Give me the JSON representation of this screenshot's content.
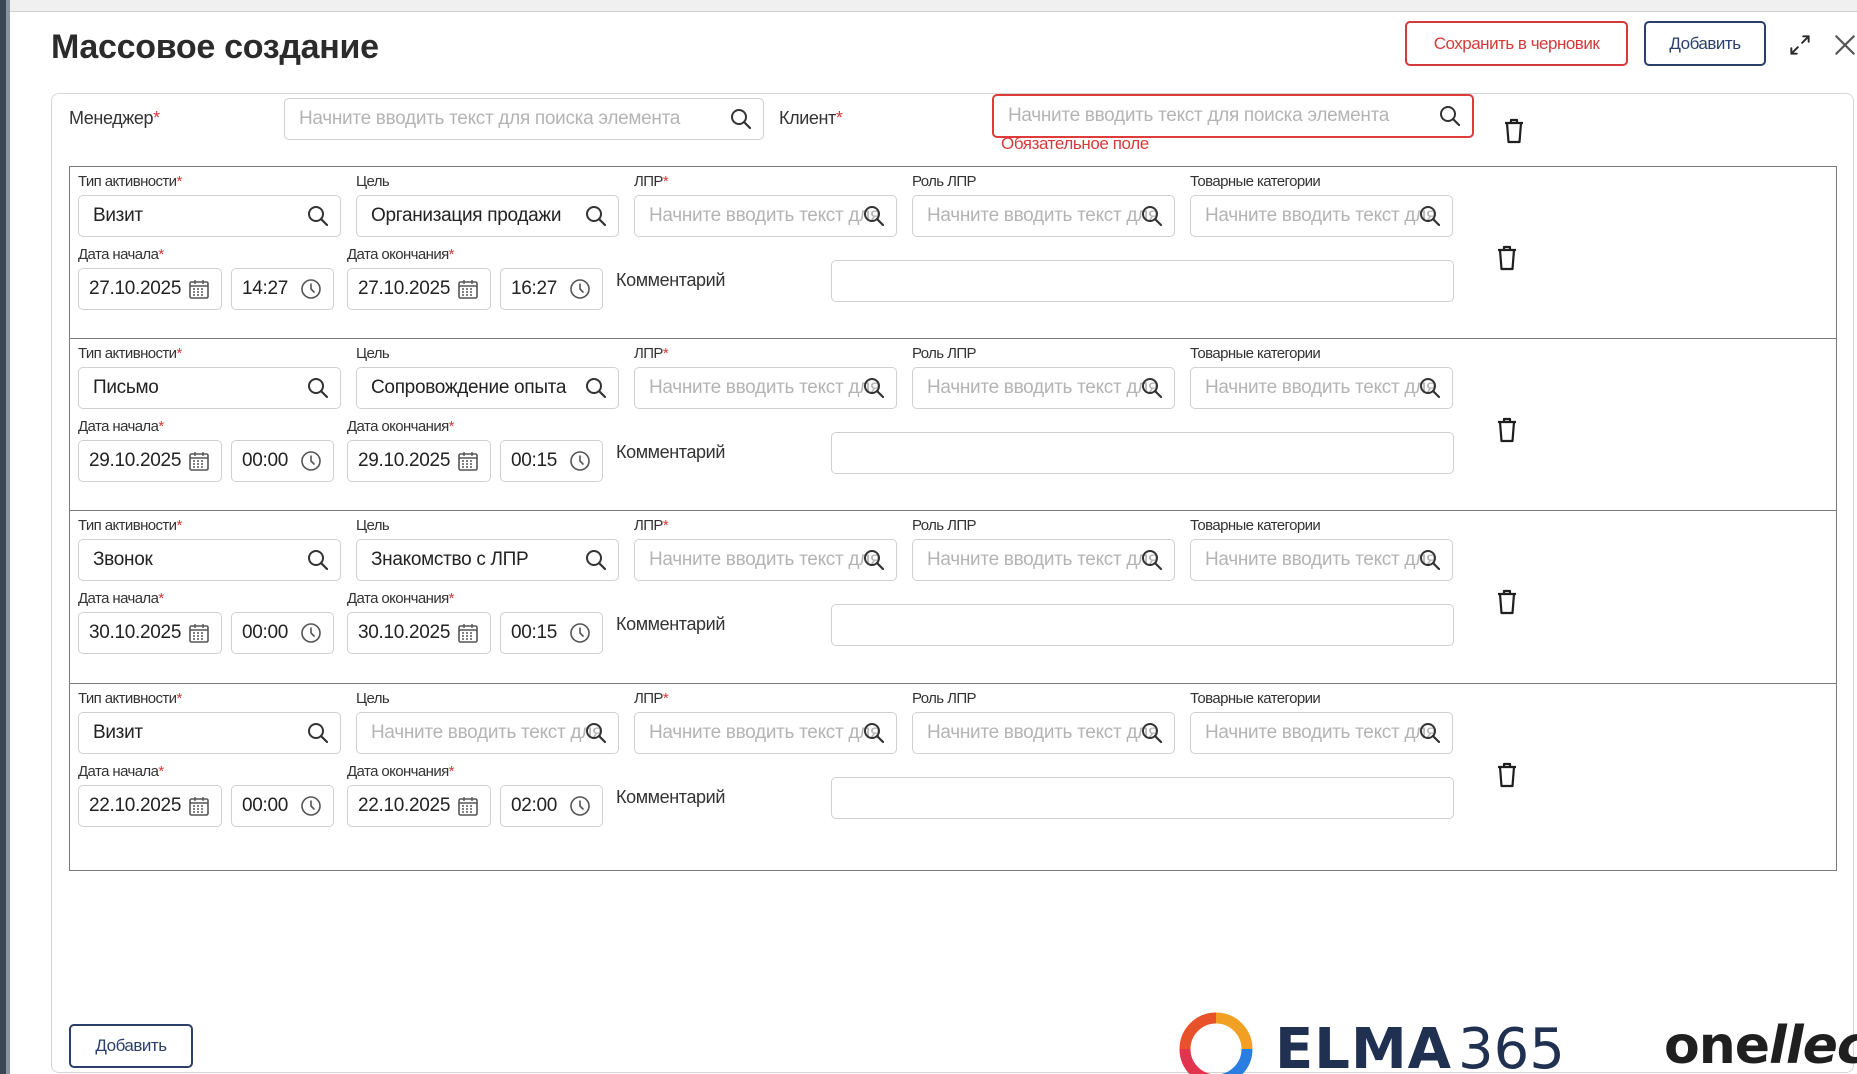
{
  "modal": {
    "title": "Массовое создание",
    "save_draft_label": "Сохранить в черновик",
    "add_top_label": "Добавить",
    "add_bottom_label": "Добавить"
  },
  "header_row": {
    "manager_label": "Менеджер",
    "manager_placeholder": "Начните вводить текст для поиска элемента",
    "client_label": "Клиент",
    "client_placeholder": "Начните вводить текст для поиска элемента",
    "client_error": "Обязательное поле"
  },
  "labels": {
    "activity_type": "Тип активности",
    "goal": "Цель",
    "lpr": "ЛПР",
    "lpr_role": "Роль ЛПР",
    "product_categories": "Товарные категории",
    "start_date": "Дата начала",
    "end_date": "Дата окончания",
    "comment": "Комментарий",
    "required_mark": "*",
    "short_placeholder": "Начните вводить текст для"
  },
  "rows": [
    {
      "activity_type": "Визит",
      "goal": "Организация продажи",
      "start_date": "27.10.2025",
      "start_time": "14:27",
      "end_date": "27.10.2025",
      "end_time": "16:27"
    },
    {
      "activity_type": "Письмо",
      "goal": "Сопровождение опыта",
      "start_date": "29.10.2025",
      "start_time": "00:00",
      "end_date": "29.10.2025",
      "end_time": "00:15"
    },
    {
      "activity_type": "Звонок",
      "goal": "Знакомство с ЛПР",
      "start_date": "30.10.2025",
      "start_time": "00:00",
      "end_date": "30.10.2025",
      "end_time": "00:15"
    },
    {
      "activity_type": "Визит",
      "goal": "",
      "start_date": "22.10.2025",
      "start_time": "00:00",
      "end_date": "22.10.2025",
      "end_time": "02:00"
    }
  ],
  "branding": {
    "logo_text": "ELMA",
    "logo_number": "365",
    "partner_a": "one",
    "partner_b": "llect"
  },
  "colors": {
    "accent_red": "#d53a3a",
    "accent_navy": "#2a3f6b",
    "brand_navy": "#1f3050"
  },
  "icons": [
    "search-icon",
    "calendar-icon",
    "clock-icon",
    "trash-icon",
    "expand-icon",
    "close-icon"
  ]
}
